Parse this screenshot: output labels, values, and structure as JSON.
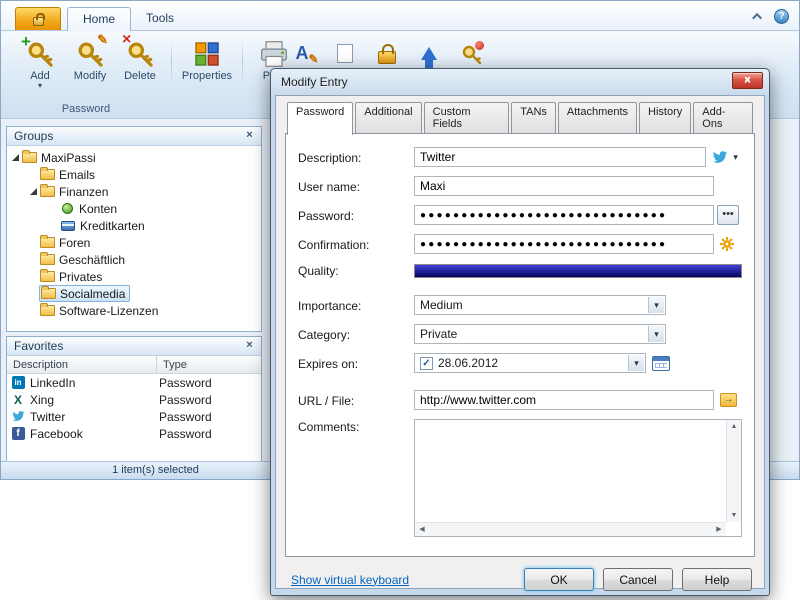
{
  "window": {
    "app_tabs": {
      "home": "Home",
      "tools": "Tools"
    },
    "ribbon": {
      "add": "Add",
      "modify": "Modify",
      "delete": "Delete",
      "properties": "Properties",
      "print": "Print",
      "group_password": "Password"
    },
    "groups": {
      "title": "Groups",
      "items": [
        {
          "label": "MaxiPassi"
        },
        {
          "label": "Emails"
        },
        {
          "label": "Finanzen"
        },
        {
          "label": "Konten"
        },
        {
          "label": "Kreditkarten"
        },
        {
          "label": "Foren"
        },
        {
          "label": "Geschäftlich"
        },
        {
          "label": "Privates"
        },
        {
          "label": "Socialmedia"
        },
        {
          "label": "Software-Lizenzen"
        }
      ]
    },
    "favorites": {
      "title": "Favorites",
      "columns": {
        "description": "Description",
        "type": "Type"
      },
      "rows": [
        {
          "description": "LinkedIn",
          "type": "Password"
        },
        {
          "description": "Xing",
          "type": "Password"
        },
        {
          "description": "Twitter",
          "type": "Password"
        },
        {
          "description": "Facebook",
          "type": "Password"
        }
      ]
    },
    "statusbar": "1 item(s) selected"
  },
  "dialog": {
    "title": "Modify Entry",
    "tabs": [
      "Password",
      "Additional",
      "Custom Fields",
      "TANs",
      "Attachments",
      "History",
      "Add-Ons"
    ],
    "form": {
      "description": {
        "label": "Description:",
        "value": "Twitter"
      },
      "username": {
        "label": "User name:",
        "value": "Maxi"
      },
      "password": {
        "label": "Password:",
        "value": "●●●●●●●●●●●●●●●●●●●●●●●●●●●●●●",
        "reveal_button": "•••"
      },
      "confirmation": {
        "label": "Confirmation:",
        "value": "●●●●●●●●●●●●●●●●●●●●●●●●●●●●●●"
      },
      "quality": {
        "label": "Quality:",
        "percent": 100
      },
      "importance": {
        "label": "Importance:",
        "value": "Medium"
      },
      "category": {
        "label": "Category:",
        "value": "Private"
      },
      "expires": {
        "label": "Expires on:",
        "value": "28.06.2012",
        "checked": true,
        "checkbox_glyph": "✓"
      },
      "url": {
        "label": "URL / File:",
        "value": "http://www.twitter.com"
      },
      "comments": {
        "label": "Comments:",
        "value": ""
      }
    },
    "footer": {
      "keyboard_link": "Show virtual keyboard",
      "ok": "OK",
      "cancel": "Cancel",
      "help": "Help"
    }
  },
  "colors": {
    "quality_bar_top": "#4343d8",
    "quality_bar_bottom": "#04045f",
    "tree_selection": "#cde3f8",
    "close_button_red": "#c9473a"
  }
}
